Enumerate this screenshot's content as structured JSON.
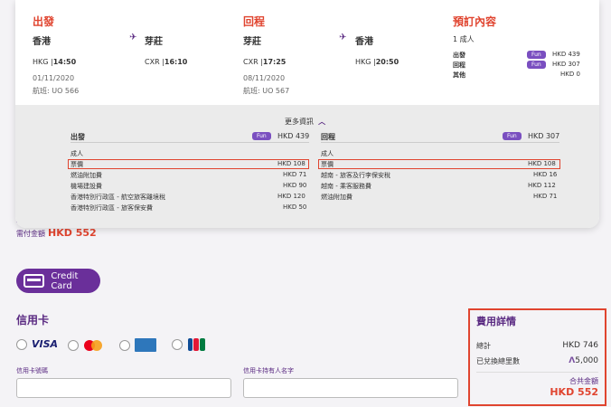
{
  "background": {
    "due_label": "需付金額",
    "due_amount": "HKD 552",
    "credit_card_button": "Credit Card",
    "credit_card_title": "信用卡",
    "payment_methods": [
      "VISA",
      "mastercard",
      "AMERICAN EXPRESS",
      "JCB"
    ],
    "card_number_label": "信用卡號碼",
    "card_holder_label": "信用卡持有人名字"
  },
  "summary": {
    "title": "費用詳情",
    "total_label": "總計",
    "total_value": "HKD 746",
    "miles_label": "已兌換總里數",
    "miles_value": "5,000",
    "grand_label": "合共金額",
    "grand_value": "HKD 552"
  },
  "card": {
    "outbound": {
      "title": "出發",
      "from_city": "香港",
      "to_city": "芽莊",
      "from_code_time": "HKG |",
      "from_time": "14:50",
      "to_code_time": "CXR |",
      "to_time": "16:10",
      "date": "01/11/2020",
      "flight": "航班: UO 566"
    },
    "inbound": {
      "title": "回程",
      "from_city": "芽莊",
      "to_city": "香港",
      "from_code_time": "CXR |",
      "from_time": "17:25",
      "to_code_time": "HKG |",
      "to_time": "20:50",
      "date": "08/11/2020",
      "flight": "航班: UO 567"
    },
    "booking": {
      "title": "預訂內容",
      "pax": "1 成人",
      "rows": [
        {
          "label": "出發",
          "badge": "Fun",
          "value": "HKD 439"
        },
        {
          "label": "回程",
          "badge": "Fun",
          "value": "HKD 307"
        },
        {
          "label": "其他",
          "badge": "",
          "value": "HKD 0"
        }
      ]
    },
    "more_info": "更多資訊",
    "detail_out": {
      "title": "出發",
      "badge": "Fun",
      "total": "HKD 439",
      "pax": "成人",
      "items": [
        {
          "label": "票價",
          "value": "HKD 108"
        },
        {
          "label": "燃油附加費",
          "value": "HKD 71"
        },
        {
          "label": "機場建設費",
          "value": "HKD 90"
        },
        {
          "label": "香港特別行政區 - 航空旅客離境稅",
          "value": "HKD 120"
        },
        {
          "label": "香港特別行政區 - 旅客保安費",
          "value": "HKD 50"
        }
      ]
    },
    "detail_in": {
      "title": "回程",
      "badge": "Fun",
      "total": "HKD 307",
      "pax": "成人",
      "items": [
        {
          "label": "票價",
          "value": "HKD 108"
        },
        {
          "label": "越南 - 旅客及行李保安稅",
          "value": "HKD 16"
        },
        {
          "label": "越南 - 乘客服務費",
          "value": "HKD 112"
        },
        {
          "label": "燃油附加費",
          "value": "HKD 71"
        }
      ]
    }
  }
}
